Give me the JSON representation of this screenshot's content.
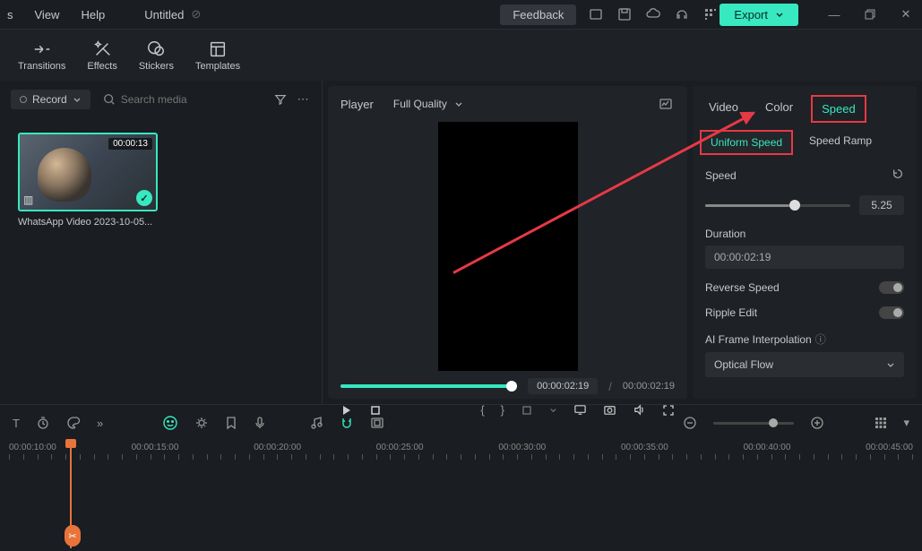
{
  "menubar": {
    "items": [
      "s",
      "View",
      "Help"
    ],
    "title": "Untitled",
    "feedback": "Feedback",
    "export": "Export"
  },
  "toolbar": {
    "tabs": [
      {
        "label": "Transitions",
        "id": "transitions"
      },
      {
        "label": "Effects",
        "id": "effects"
      },
      {
        "label": "Stickers",
        "id": "stickers"
      },
      {
        "label": "Templates",
        "id": "templates"
      }
    ]
  },
  "left": {
    "record": "Record",
    "search_placeholder": "Search media",
    "media": {
      "duration": "00:00:13",
      "name": "WhatsApp Video 2023-10-05..."
    }
  },
  "player": {
    "label": "Player",
    "quality": "Full Quality",
    "current": "00:00:02:19",
    "total": "00:00:02:19"
  },
  "right": {
    "tabs": [
      "Video",
      "Color",
      "Speed"
    ],
    "active_tab": 2,
    "sub_tabs": [
      "Uniform Speed",
      "Speed Ramp"
    ],
    "active_sub": 0,
    "speed_label": "Speed",
    "speed_value": "5.25",
    "speed_pct": 58,
    "duration_label": "Duration",
    "duration_value": "00:00:02:19",
    "reverse_label": "Reverse Speed",
    "ripple_label": "Ripple Edit",
    "ai_label": "AI Frame Interpolation",
    "ai_value": "Optical Flow"
  },
  "timeline": {
    "marks": [
      "00:00:10:00",
      "00:00:15:00",
      "00:00:20:00",
      "00:00:25:00",
      "00:00:30:00",
      "00:00:35:00",
      "00:00:40:00",
      "00:00:45:00"
    ]
  }
}
